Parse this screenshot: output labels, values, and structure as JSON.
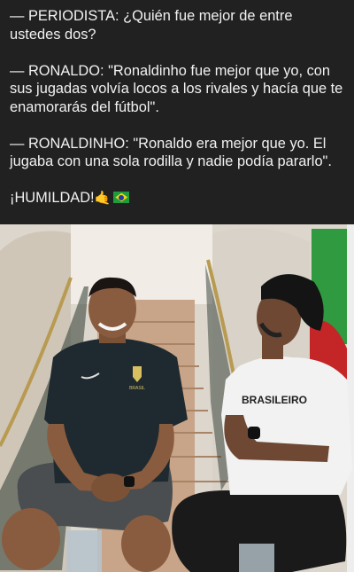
{
  "post": {
    "lines": [
      "— PERIODISTA: ¿Quién fue mejor de entre ustedes dos?",
      "— RONALDO: \"Ronaldinho fue mejor que yo, con sus jugadas volvía locos a los rivales y hacía que te enamorarás del fútbol\".",
      "— RONALDINHO: \"Ronaldo era mejor que yo. El jugaba con una sola rodilla y nadie podía pararlo\"."
    ],
    "closing": "¡HUMILDAD!",
    "emoji_hand": "🤙",
    "flag_icon": "brazil-flag-icon"
  },
  "photo": {
    "shirt_left_text": "BRASIL",
    "shirt_right_text": "BRASILEIRO",
    "colors": {
      "wall": "#e6e2dc",
      "stairs": "#c9a588",
      "shirt_left": "#1e2a30",
      "shirt_right": "#f2f2f2",
      "shorts": "#4a4e50",
      "railing_gold": "#b89a50",
      "flag_green": "#2f9a3f",
      "flag_red": "#c42628"
    }
  }
}
